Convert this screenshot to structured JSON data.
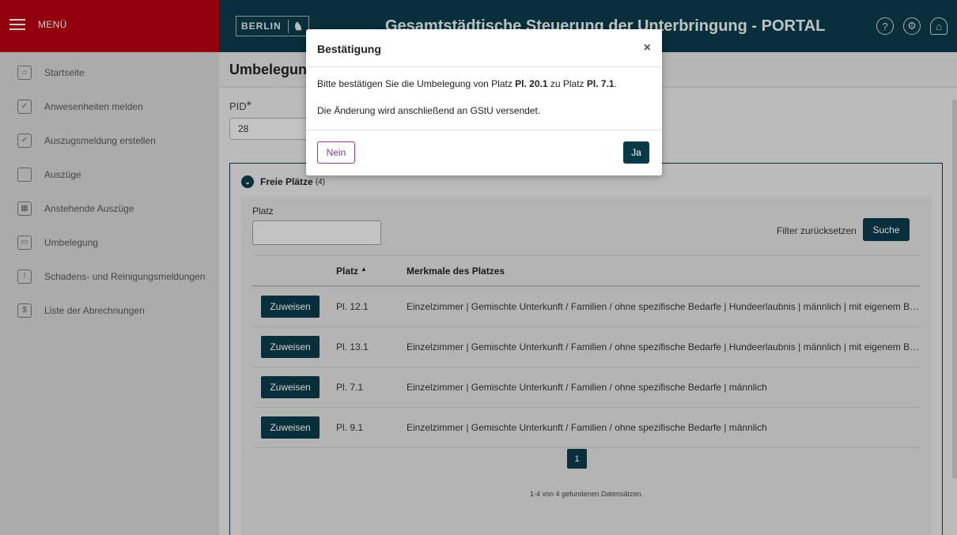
{
  "header": {
    "menu_label": "MENÜ",
    "logo_text": "BERLIN",
    "app_title": "Gesamtstädtische Steuerung der Unterbringung - PORTAL",
    "icons": [
      "help-icon",
      "gear-icon",
      "user-icon"
    ]
  },
  "sidebar": {
    "items": [
      {
        "label": "Startseite",
        "icon": "home-icon"
      },
      {
        "label": "Anwesenheiten melden",
        "icon": "person-check-icon"
      },
      {
        "label": "Auszugsmeldung erstellen",
        "icon": "calendar-check-icon"
      },
      {
        "label": "Auszüge",
        "icon": "suitcase-icon"
      },
      {
        "label": "Anstehende Auszüge",
        "icon": "building-icon"
      },
      {
        "label": "Umbelegung",
        "icon": "bed-icon"
      },
      {
        "label": "Schadens- und Reinigungsmeldungen",
        "icon": "house-alert-icon"
      },
      {
        "label": "Liste der Abrechnungen",
        "icon": "invoice-icon"
      }
    ]
  },
  "main": {
    "page_title": "Umbelegung",
    "pid_label": "PID",
    "pid_required": "*",
    "pid_value": "28",
    "panel": {
      "title": "Freie Plätze",
      "count": "(4)",
      "platz_label": "Platz",
      "platz_value": "",
      "reset_label": "Filter zurücksetzen",
      "search_label": "Suche",
      "columns": {
        "platz": "Platz",
        "merkmale": "Merkmale des Platzes"
      },
      "assign_label": "Zuweisen",
      "rows": [
        {
          "platz": "Pl. 12.1",
          "merkmale": "Einzelzimmer | Gemischte Unterkunft / Familien / ohne spezifische Bedarfe | Hundeerlaubnis | männlich | mit eigenem Bad..."
        },
        {
          "platz": "Pl. 13.1",
          "merkmale": "Einzelzimmer | Gemischte Unterkunft / Familien / ohne spezifische Bedarfe | Hundeerlaubnis | männlich | mit eigenem Bad..."
        },
        {
          "platz": "Pl. 7.1",
          "merkmale": "Einzelzimmer | Gemischte Unterkunft / Familien / ohne spezifische Bedarfe | männlich"
        },
        {
          "platz": "Pl. 9.1",
          "merkmale": "Einzelzimmer | Gemischte Unterkunft / Familien / ohne spezifische Bedarfe | männlich"
        }
      ],
      "current_page": "1",
      "records_text": "1-4 von 4 gefundenen Datensätzen."
    }
  },
  "modal": {
    "title": "Bestätigung",
    "close": "×",
    "line1_pre": "Bitte bestätigen Sie die Umbelegung von Platz ",
    "line1_from": "Pl. 20.1",
    "line1_mid": " zu Platz ",
    "line1_to": "Pl. 7.1",
    "line1_post": ".",
    "line2": "Die Änderung wird anschließend an GStU versendet.",
    "no_label": "Nein",
    "yes_label": "Ja"
  },
  "colors": {
    "brand_red": "#b20010",
    "primary": "#0a3a48",
    "nein_border": "#8a3a8a"
  }
}
